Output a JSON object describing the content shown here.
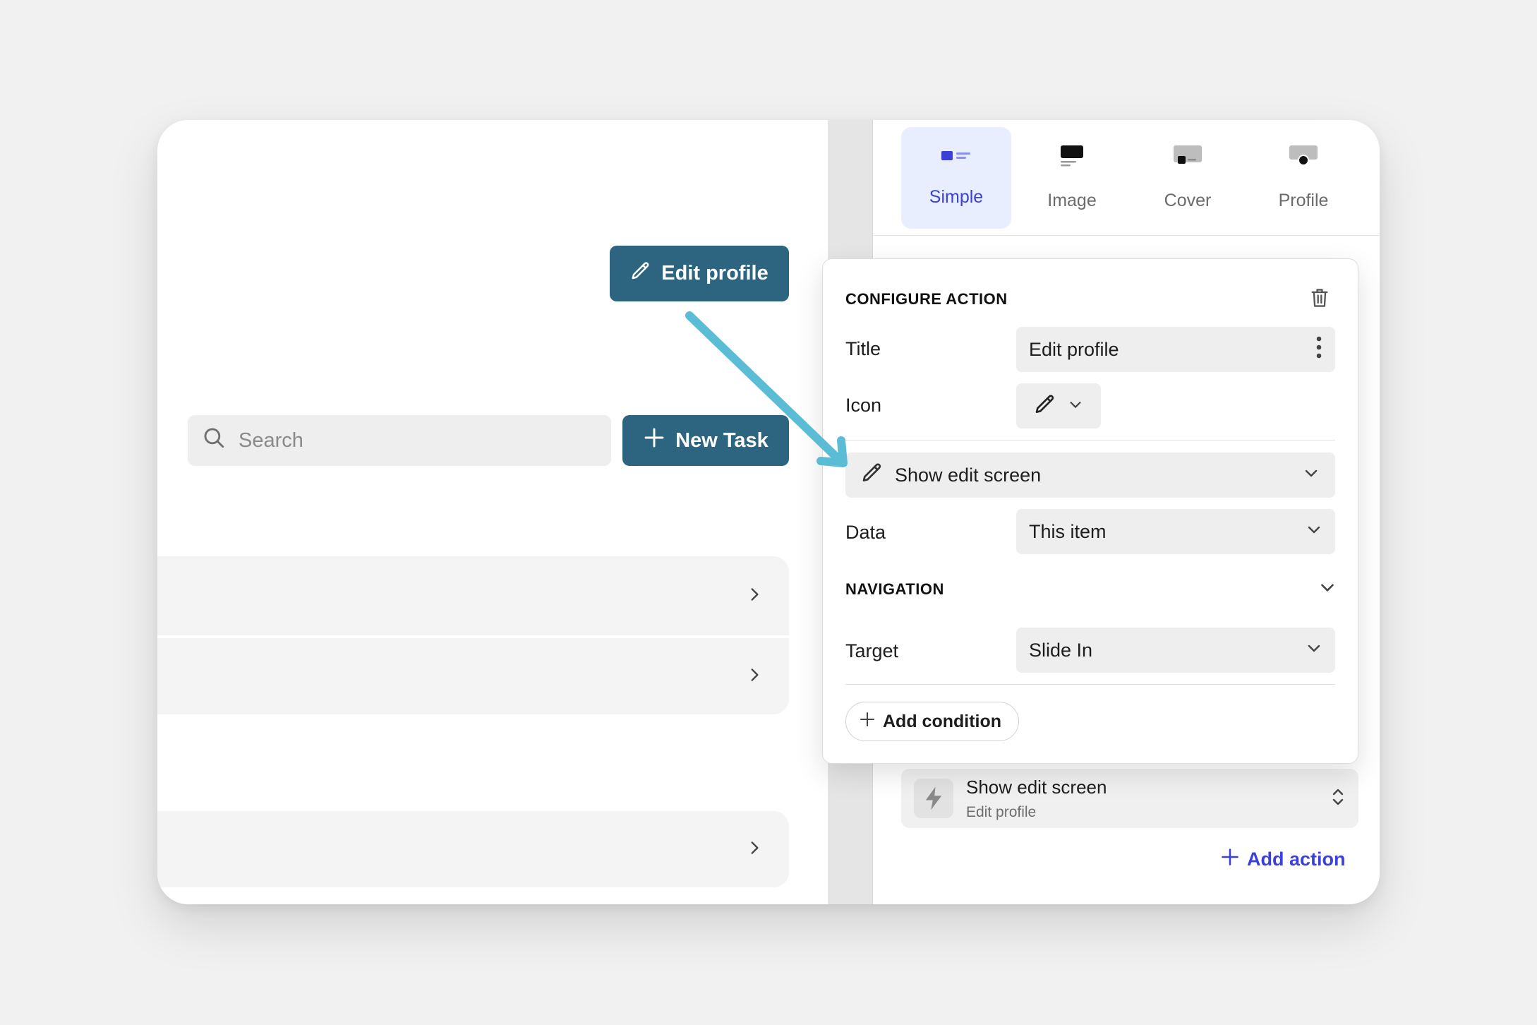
{
  "preview": {
    "edit_profile_label": "Edit profile",
    "search_placeholder": "Search",
    "new_task_label": "New Task"
  },
  "styles": {
    "tabs": [
      {
        "label": "Simple",
        "active": true
      },
      {
        "label": "Image",
        "active": false
      },
      {
        "label": "Cover",
        "active": false
      },
      {
        "label": "Profile",
        "active": false
      }
    ]
  },
  "configure_action": {
    "heading": "CONFIGURE ACTION",
    "title_label": "Title",
    "title_value": "Edit profile",
    "icon_label": "Icon",
    "action_value": "Show edit screen",
    "data_label": "Data",
    "data_value": "This item",
    "navigation_heading": "NAVIGATION",
    "target_label": "Target",
    "target_value": "Slide In",
    "add_condition_label": "Add condition"
  },
  "action_card": {
    "title": "Show edit screen",
    "subtitle": "Edit profile"
  },
  "add_action_label": "Add action",
  "colors": {
    "primary_button": "#2d6580",
    "accent": "#3a40d8",
    "arrow": "#5bbcd6"
  }
}
